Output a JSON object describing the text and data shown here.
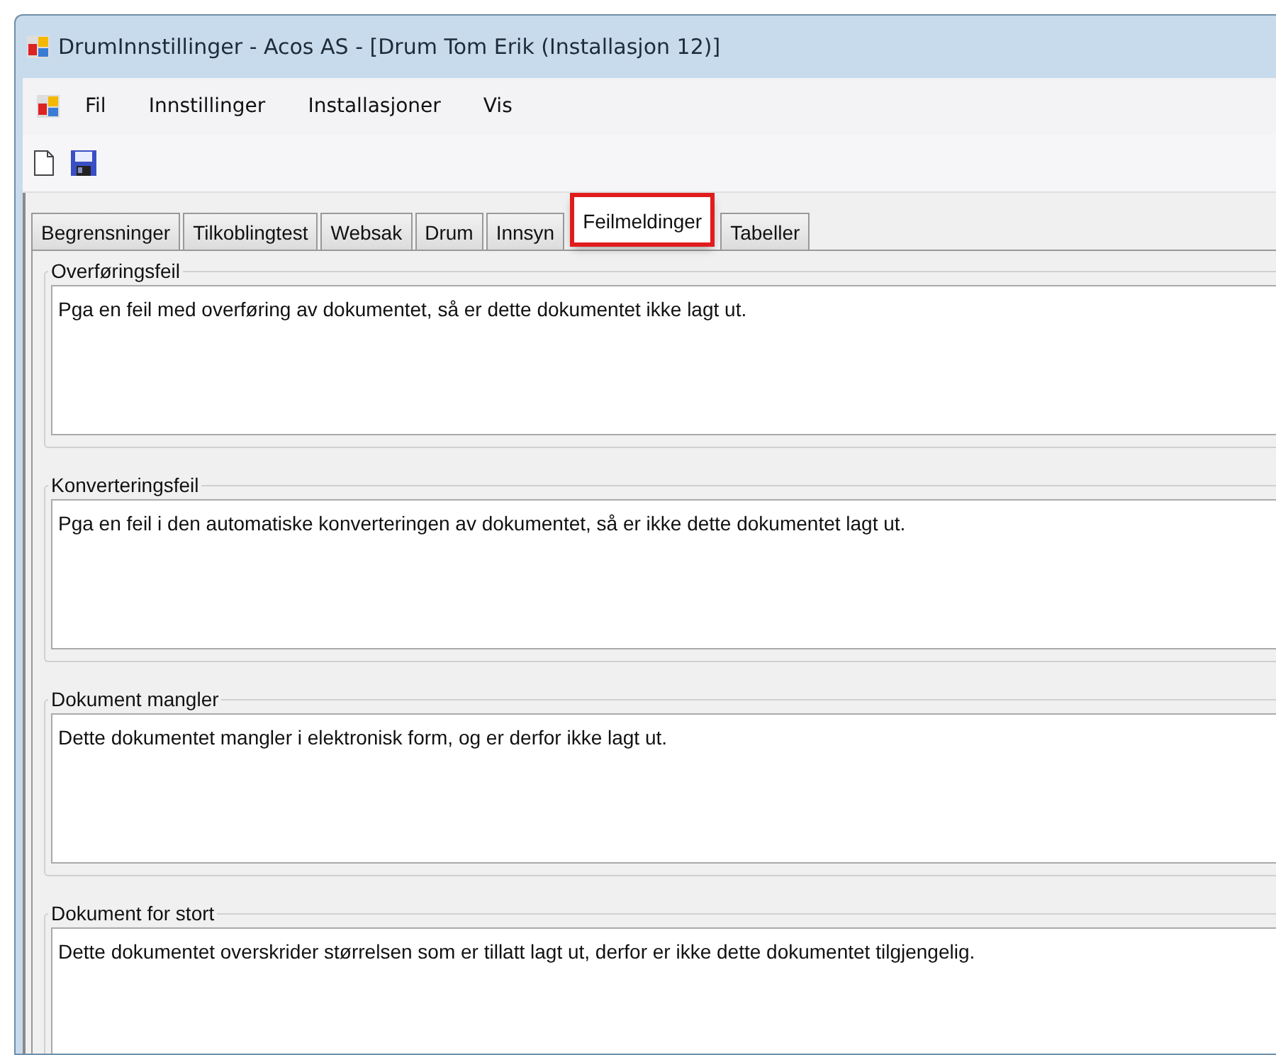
{
  "window": {
    "title": "DrumInnstillinger - Acos AS - [Drum Tom Erik (Installasjon 12)]"
  },
  "menu": [
    "Fil",
    "Innstillinger",
    "Installasjoner",
    "Vis"
  ],
  "tabs": [
    {
      "label": "Begrensninger",
      "selected": false
    },
    {
      "label": "Tilkoblingtest",
      "selected": false
    },
    {
      "label": "Websak",
      "selected": false
    },
    {
      "label": "Drum",
      "selected": false
    },
    {
      "label": "Innsyn",
      "selected": false
    },
    {
      "label": "Feilmeldinger",
      "selected": true
    },
    {
      "label": "Tabeller",
      "selected": false
    }
  ],
  "groups": [
    {
      "title": "Overføringsfeil",
      "value": "Pga en feil med overføring av dokumentet, så er dette dokumentet ikke lagt ut."
    },
    {
      "title": "Konverteringsfeil",
      "value": "Pga en feil i den automatiske konverteringen av dokumentet, så er ikke dette dokumentet lagt ut."
    },
    {
      "title": "Dokument mangler",
      "value": "Dette dokumentet mangler i elektronisk form, og er derfor ikke lagt ut."
    },
    {
      "title": "Dokument for stort",
      "value": "Dette dokumentet overskrider størrelsen som er tillatt lagt ut, derfor er ikke dette dokumentet tilgjengelig."
    }
  ]
}
